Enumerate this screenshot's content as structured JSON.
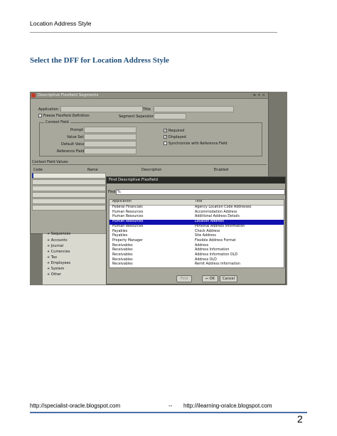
{
  "header": {
    "text": "Location Address Style"
  },
  "heading": "Select the DFF for Location Address Style",
  "screenshot": {
    "window_title": "Descriptive Flexfield Segments",
    "window_controls": "≤ × ×",
    "labels": {
      "application": "Application",
      "title": "Title",
      "freeze": "Freeze Flexfield Definition",
      "segment_separator": "Segment Separator",
      "context_field": "Context Field",
      "prompt": "Prompt",
      "value_set": "Value Set",
      "default_value": "Default Value",
      "reference_field": "Reference Field",
      "required": "Required",
      "displayed": "Displayed",
      "synchronize": "Synchronize with Reference Field",
      "context_field_values": "Context Field Values",
      "col_code": "Code",
      "col_name": "Name",
      "col_description": "Description",
      "col_enabled": "Enabled"
    },
    "nav_items": [
      "Sequences",
      "Accounts",
      "Journal",
      "Currencies",
      "Tax",
      "Employees",
      "System",
      "Other"
    ],
    "find_dialog": {
      "title": "Find Descriptive Flexfield",
      "find_label": "Find",
      "find_value": "%",
      "col_application": "Application",
      "col_title": "Title",
      "rows": [
        {
          "application": "Federal Financials",
          "title": "Agency Location Code Addresses"
        },
        {
          "application": "Human Resources",
          "title": "Accommodation Address"
        },
        {
          "application": "Human Resources",
          "title": "Additional Address Details"
        },
        {
          "application": "Human Resources",
          "title": "Location Address"
        },
        {
          "application": "Human Resources",
          "title": "Personal Address Information"
        },
        {
          "application": "Payables",
          "title": "Check Address"
        },
        {
          "application": "Payables",
          "title": "Site Address"
        },
        {
          "application": "Property Manager",
          "title": "Flexible Address Format"
        },
        {
          "application": "Receivables",
          "title": "Address"
        },
        {
          "application": "Receivables",
          "title": "Address Information"
        },
        {
          "application": "Receivables",
          "title": "Address Information OLD"
        },
        {
          "application": "Receivables",
          "title": "Address OLD"
        },
        {
          "application": "Receivables",
          "title": "Remit Address Information"
        }
      ],
      "selected_index": 3,
      "btn_find": "Find",
      "btn_ok": "OK",
      "btn_cancel": "Cancel"
    }
  },
  "footer": {
    "left": "http://specialist-oracle.blogspot.com",
    "sep": "--",
    "right": "http://ilearning-oralce.blogspot.com"
  },
  "page_number": "2"
}
